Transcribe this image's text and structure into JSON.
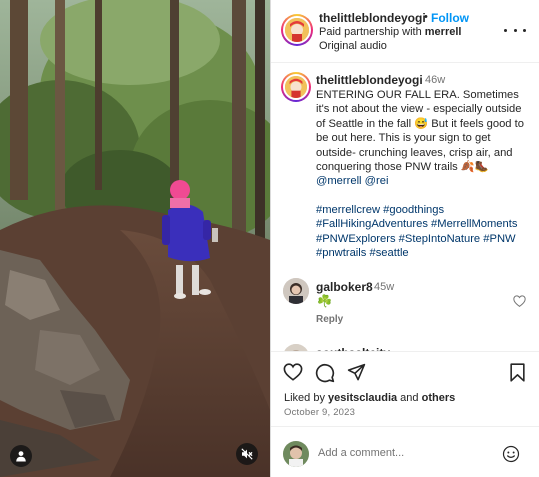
{
  "post": {
    "username": "thelittleblondeyogi",
    "separator": "•",
    "follow_label": "Follow",
    "partnership_prefix": "Paid partnership with ",
    "partner": "merrell",
    "audio": "Original audio"
  },
  "caption": {
    "username": "thelittleblondeyogi",
    "time": "46w",
    "text": "ENTERING OUR FALL ERA. Sometimes it's not about the view - especially outside of Seattle in the fall 😅 But it feels good to be out here. This is your sign to get outside- crunching leaves, crisp air, and conquering those PNW trails 🍂🥾 ",
    "mention1": "@merrell",
    "mention2": "@rei",
    "hashtags": "#merrellcrew #goodthings #FallHikingAdventures #MerrellMoments #PNWExplorers #StepIntoNature #PNW #pnwtrails #seattle"
  },
  "comments": [
    {
      "username": "galboker8",
      "time": "45w",
      "text": "☘️",
      "reply_label": "Reply"
    },
    {
      "username": "southsaltcity"
    }
  ],
  "actions": {
    "liked_by_prefix": "Liked by ",
    "liked_by_user": "yesitsclaudia",
    "liked_by_mid": " and ",
    "liked_by_others": "others",
    "date": "October 9, 2023"
  },
  "add_comment": {
    "placeholder": "Add a comment..."
  },
  "icons": [
    "user-tag-icon",
    "mute-icon",
    "more-icon",
    "heart-icon",
    "comment-icon",
    "share-icon",
    "save-icon",
    "emoji-icon"
  ],
  "colors": {
    "link": "#0095f6",
    "hashtag": "#00376b",
    "muted": "#737373",
    "text": "#262626"
  }
}
